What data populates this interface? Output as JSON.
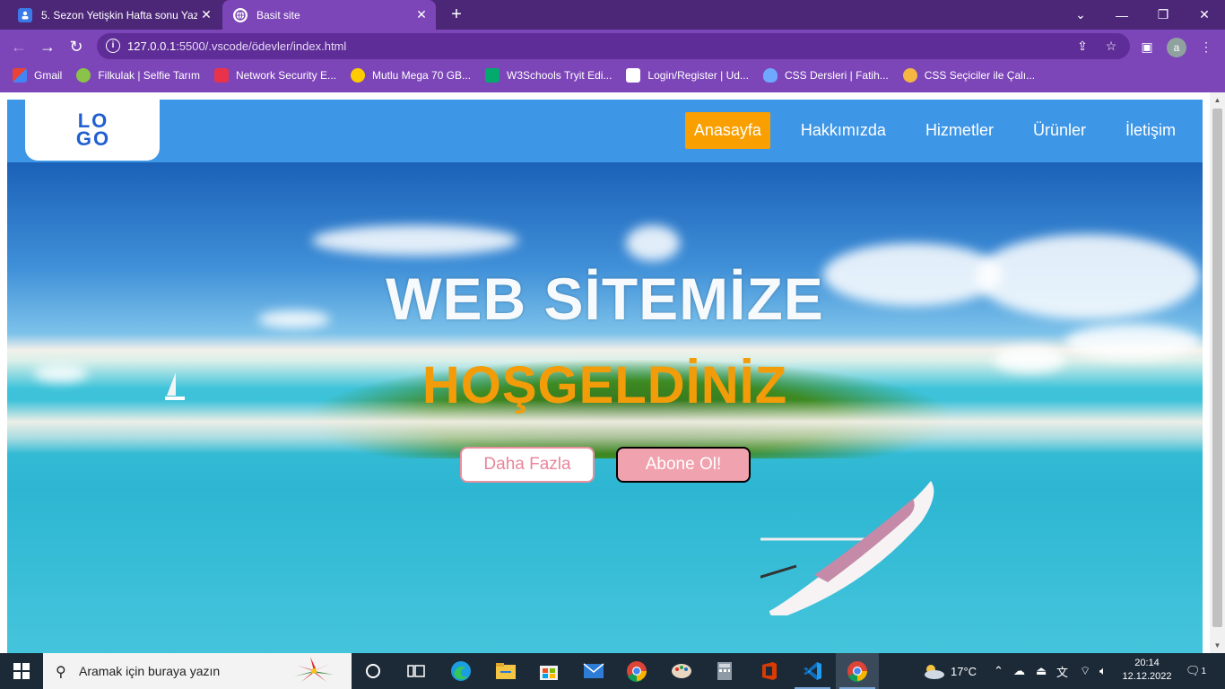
{
  "browser": {
    "tabs": [
      {
        "title": "5. Sezon Yetişkin Hafta sonu Yazılı",
        "active": false
      },
      {
        "title": "Basit site",
        "active": true
      }
    ],
    "new_tab": "+",
    "url_host": "127.0.0.1",
    "url_rest": ":5500/.vscode/ödevler/index.html",
    "profile_initial": "a",
    "bookmarks": [
      {
        "label": "Gmail",
        "color": "#ea4335"
      },
      {
        "label": "Filkulak | Selfie Tarım",
        "color": "#8bc34a"
      },
      {
        "label": "Network Security E...",
        "color": "#e8334a"
      },
      {
        "label": "Mutlu Mega 70 GB...",
        "color": "#ffcc00"
      },
      {
        "label": "W3Schools Tryit Edi...",
        "color": "#04aa6d"
      },
      {
        "label": "Login/Register | Ud...",
        "color": "#ffffff"
      },
      {
        "label": "CSS Dersleri | Fatih...",
        "color": "#6ea8ff"
      },
      {
        "label": "CSS Seçiciler ile Çalı...",
        "color": "#f5b642"
      }
    ]
  },
  "site": {
    "logo": {
      "line1": "LO",
      "line2": "GO"
    },
    "nav": [
      {
        "label": "Anasayfa",
        "active": true
      },
      {
        "label": "Hakkımızda",
        "active": false
      },
      {
        "label": "Hizmetler",
        "active": false
      },
      {
        "label": "Ürünler",
        "active": false
      },
      {
        "label": "İletişim",
        "active": false
      }
    ],
    "hero": {
      "title_line1": "WEB SİTEMİZE",
      "title_line2": "HOŞGELDİNİZ",
      "btn_more": "Daha Fazla",
      "btn_subscribe": "Abone Ol!"
    },
    "colors": {
      "header": "#3e96e6",
      "active_nav": "#f99f00",
      "accent_title": "#f39c0a"
    }
  },
  "taskbar": {
    "search_placeholder": "Aramak için buraya yazın",
    "weather": "17°C",
    "time": "20:14",
    "date": "12.12.2022",
    "notifications": "1"
  }
}
